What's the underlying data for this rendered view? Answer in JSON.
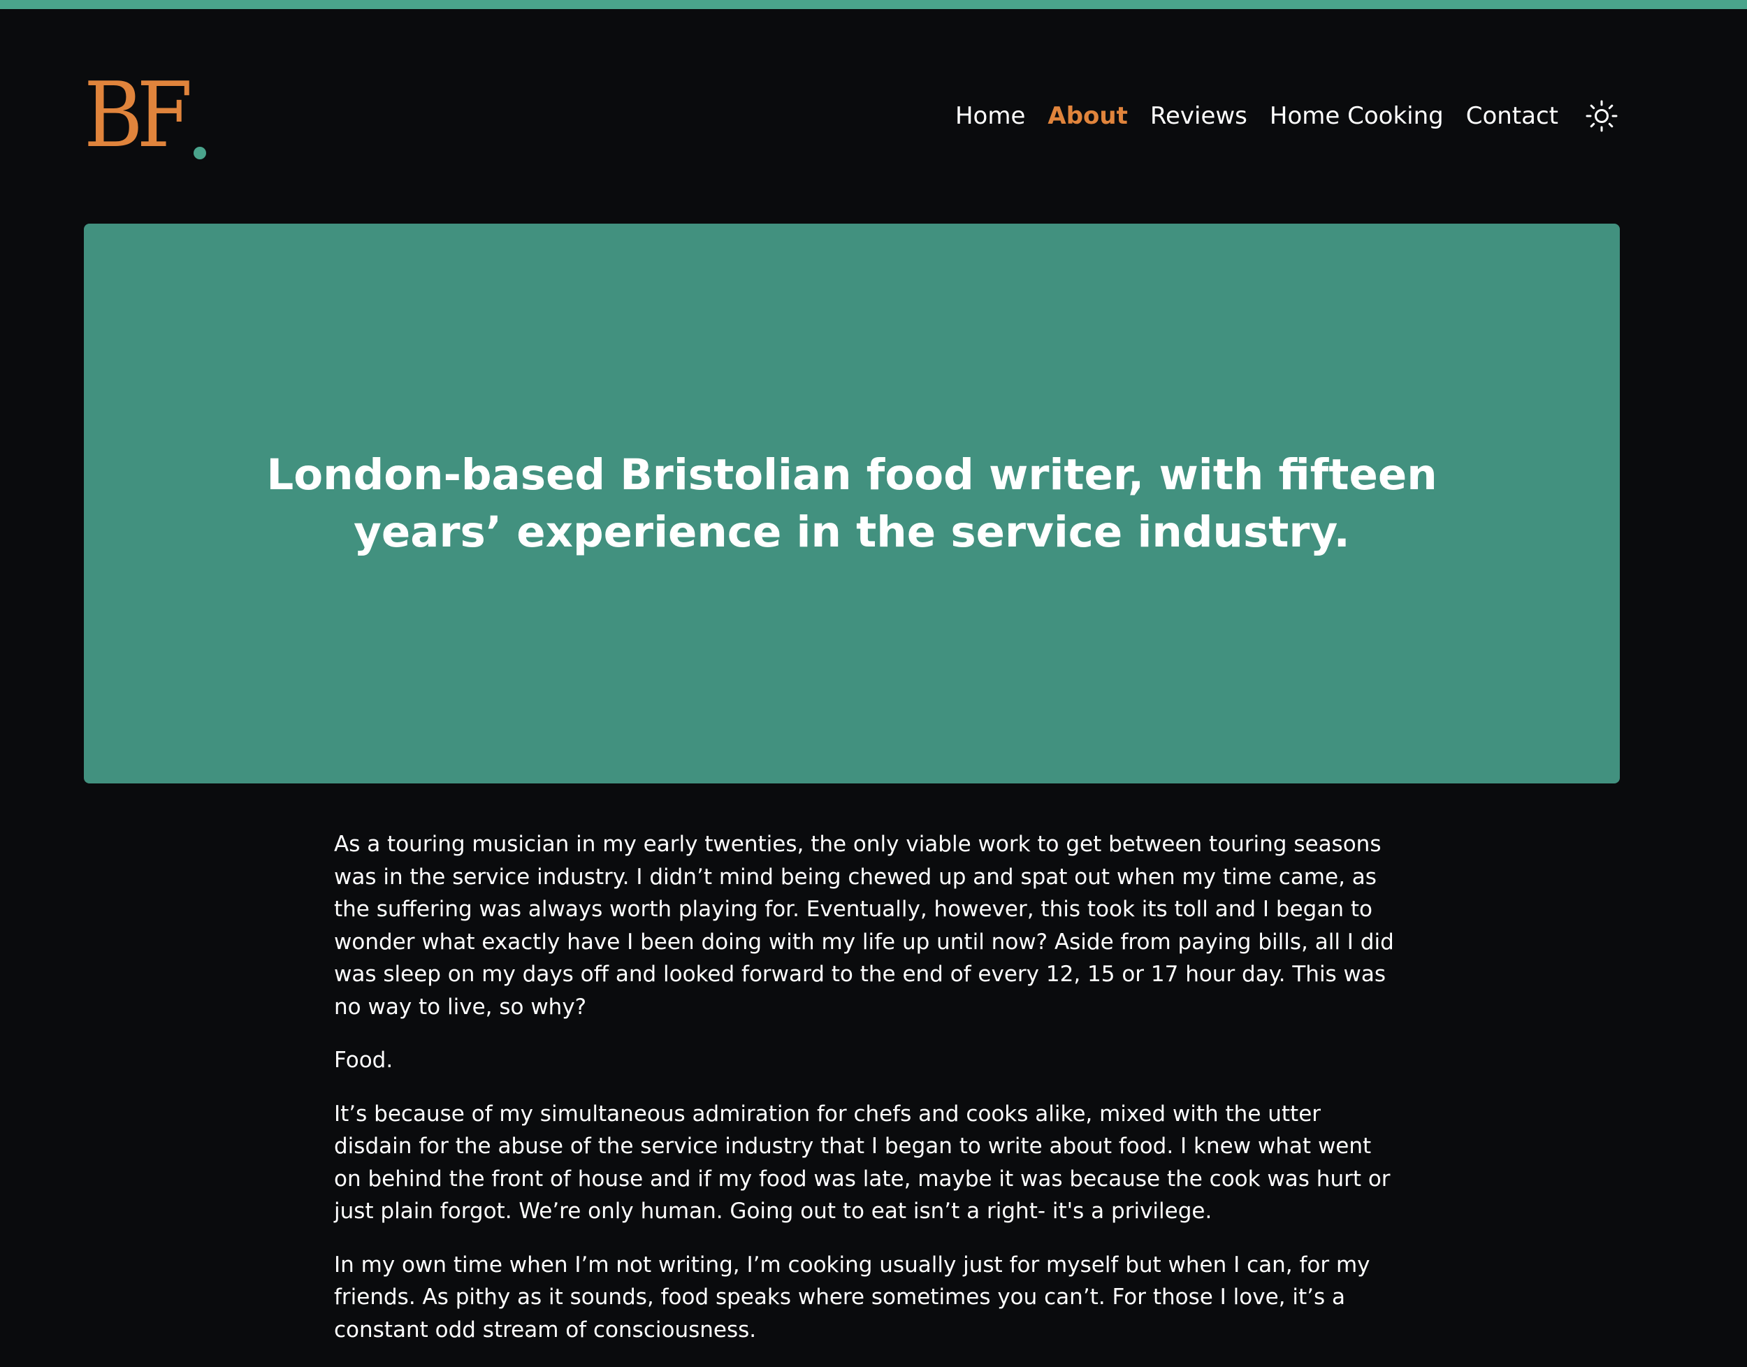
{
  "logo": {
    "text": "BF"
  },
  "nav": {
    "items": [
      {
        "label": "Home",
        "active": false
      },
      {
        "label": "About",
        "active": true
      },
      {
        "label": "Reviews",
        "active": false
      },
      {
        "label": "Home Cooking",
        "active": false
      },
      {
        "label": "Contact",
        "active": false
      }
    ],
    "theme_toggle_icon": "sun-icon"
  },
  "hero": {
    "title": "London-based Bristolian food writer, with fifteen years’ experience in the service industry."
  },
  "content": {
    "paragraphs": [
      "As a touring musician in my early twenties, the only viable work to get between touring seasons was in the service industry. I didn’t mind being chewed up and spat out when my time came, as the suffering was always worth playing for. Eventually, however, this took its toll and I began to wonder what exactly have I been doing with my life up until now? Aside from paying bills, all I did was sleep on my days off and looked forward to the end of every 12, 15 or 17 hour day. This was no way to live, so why?",
      "Food.",
      "It’s because of my simultaneous admiration for chefs and cooks alike, mixed with the utter disdain for the abuse of the service industry that I began to write about food. I knew what went on behind the front of house and if my food was late, maybe it was because the cook was hurt or just plain forgot. We’re only human. Going out to eat isn’t a right- it's a privilege.",
      "In my own time when I’m not writing, I’m cooking usually just for myself but when I can, for my friends. As pithy as it sounds, food speaks where sometimes you can’t. For those I love, it’s a constant odd stream of consciousness."
    ]
  },
  "colors": {
    "accent_orange": "#e0843c",
    "accent_teal": "#4aa48c",
    "hero_bg": "#42917f",
    "page_bg": "#0a0b0d"
  }
}
